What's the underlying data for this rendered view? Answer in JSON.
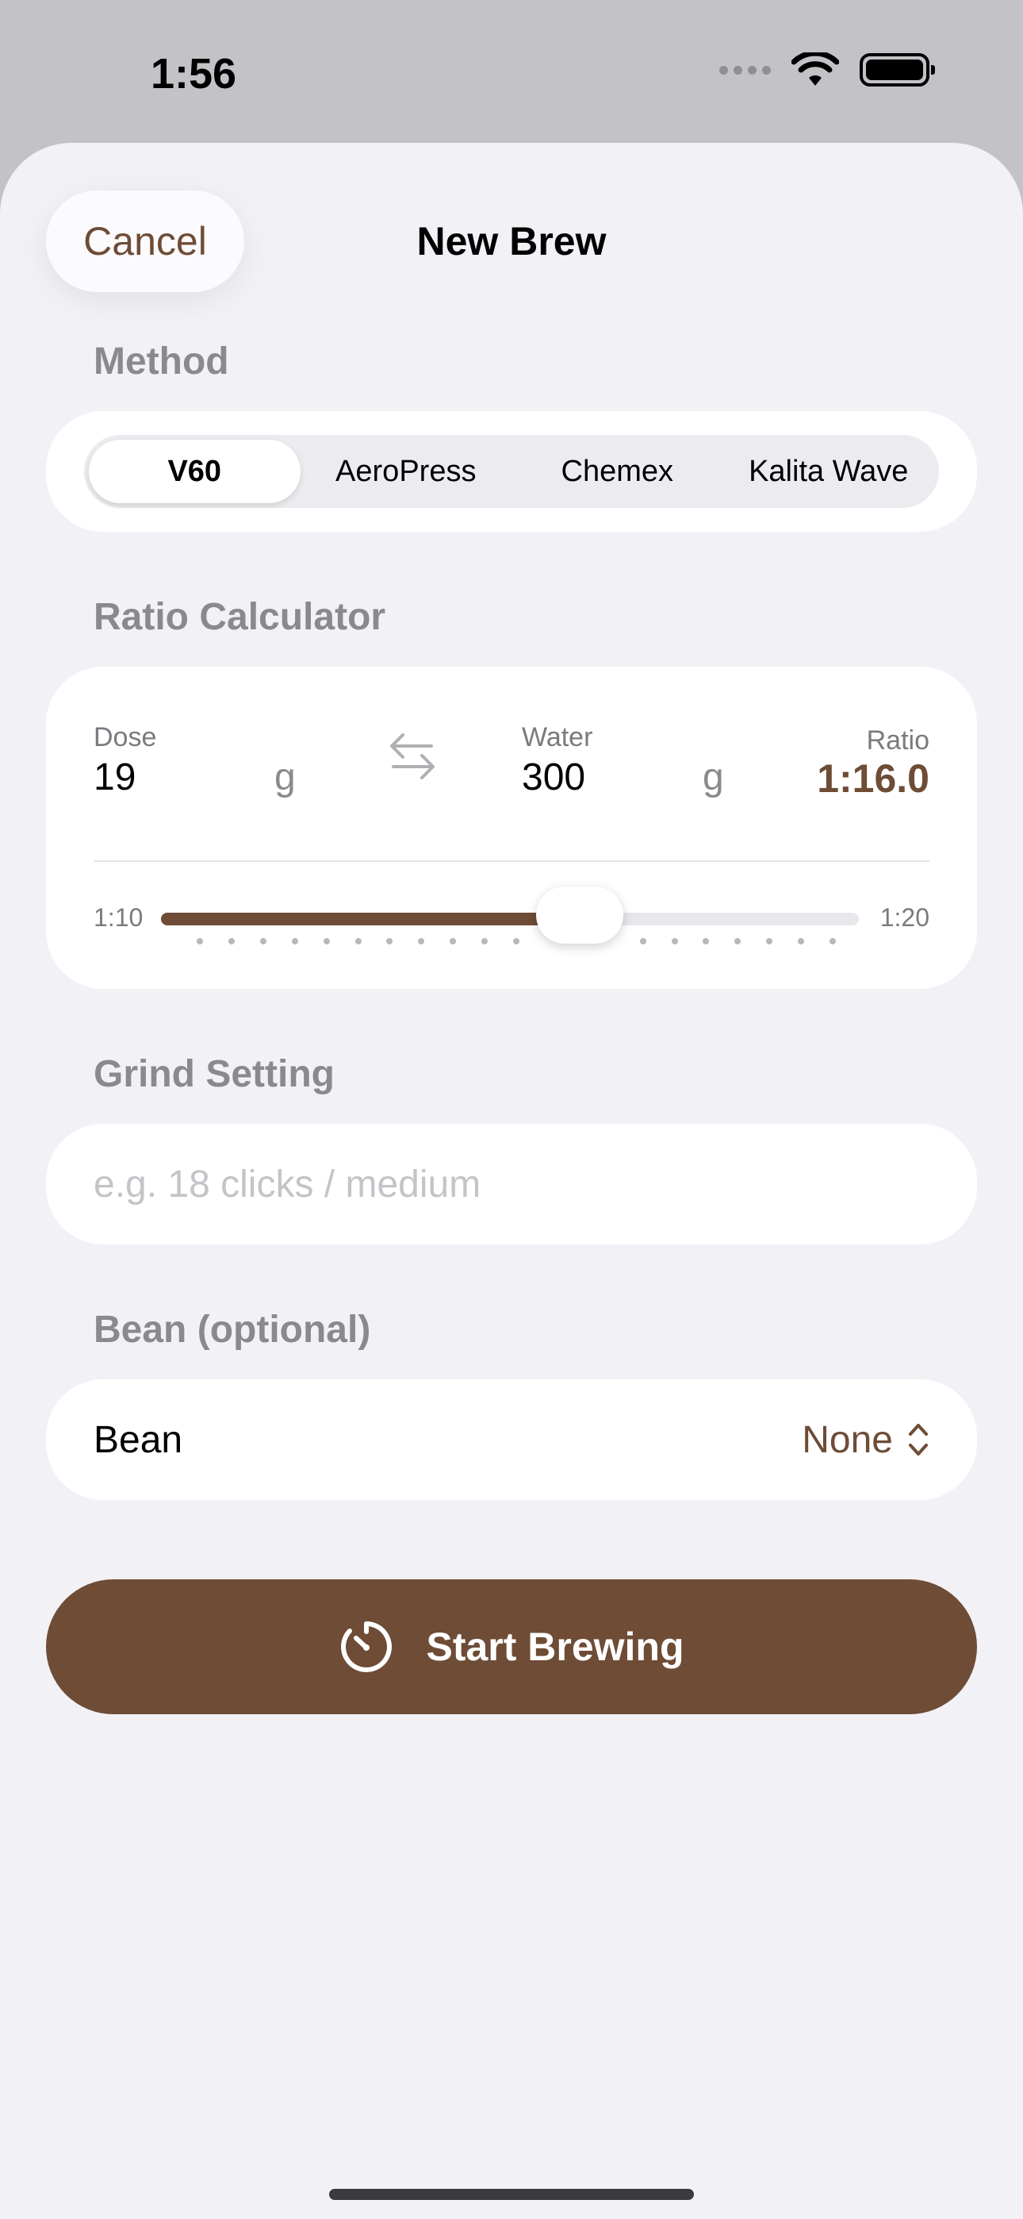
{
  "status_bar": {
    "time": "1:56"
  },
  "header": {
    "cancel_label": "Cancel",
    "title": "New Brew"
  },
  "method": {
    "section_label": "Method",
    "options": [
      "V60",
      "AeroPress",
      "Chemex",
      "Kalita Wave"
    ],
    "selected": "V60"
  },
  "ratio_calculator": {
    "section_label": "Ratio Calculator",
    "dose_label": "Dose",
    "dose_value": "19",
    "dose_unit": "g",
    "water_label": "Water",
    "water_value": "300",
    "water_unit": "g",
    "ratio_label": "Ratio",
    "ratio_value": "1:16.0",
    "slider_min_label": "1:10",
    "slider_max_label": "1:20",
    "slider_min": 10,
    "slider_max": 20,
    "slider_value": 16.0
  },
  "grind": {
    "section_label": "Grind Setting",
    "placeholder": "e.g. 18 clicks / medium",
    "value": ""
  },
  "bean": {
    "section_label": "Bean (optional)",
    "row_label": "Bean",
    "selected_value": "None"
  },
  "start_button": {
    "label": "Start Brewing"
  },
  "colors": {
    "accent": "#6e4c36",
    "background": "#f2f1f6",
    "card": "#ffffff"
  }
}
